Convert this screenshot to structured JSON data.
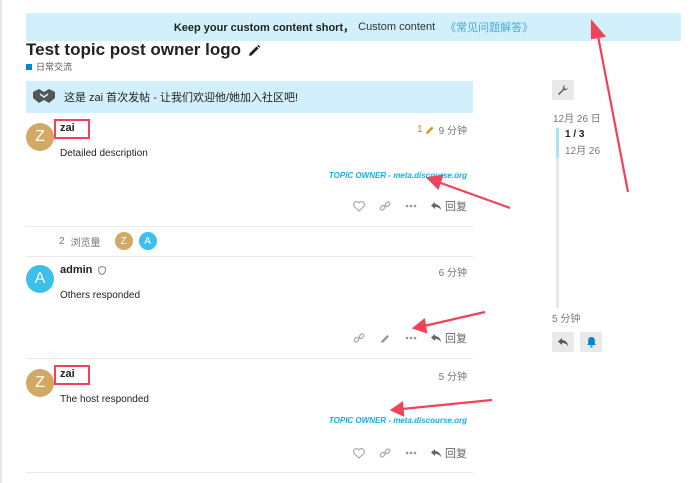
{
  "banner": {
    "strong": "Keep your custom content short，",
    "text": "Custom content",
    "link": "《常见问题解答》"
  },
  "topic": {
    "title": "Test topic post owner logo",
    "category": "日常交流",
    "welcome": "这是 zai 首次发帖 - 让我们欢迎他/她加入社区吧!"
  },
  "posts": [
    {
      "username": "zai",
      "avatar_letter": "Z",
      "edit_count": "1",
      "time": "9 分钟",
      "body": "Detailed description",
      "owner_tag": "TOPIC OWNER - meta.discourse.org",
      "reply_label": "回复"
    },
    {
      "username": "admin",
      "avatar_letter": "A",
      "time": "6 分钟",
      "body": "Others responded",
      "reply_label": "回复"
    },
    {
      "username": "zai",
      "avatar_letter": "Z",
      "time": "5 分钟",
      "body": "The host responded",
      "owner_tag": "TOPIC OWNER - meta.discourse.org",
      "reply_label": "回复"
    }
  ],
  "views": {
    "count": "2",
    "label": "浏览量",
    "avatars": [
      "Z",
      "A"
    ]
  },
  "timeline": {
    "start_date": "12月 26 日",
    "position": "1 / 3",
    "position_date": "12月 26",
    "end_label": "5 分钟"
  },
  "colors": {
    "accent": "#0cb1e8",
    "banner_bg": "#d1f0fc",
    "highlight": "#f04258",
    "tan_avatar": "#d2a865",
    "blue_avatar": "#3cbfe8"
  }
}
